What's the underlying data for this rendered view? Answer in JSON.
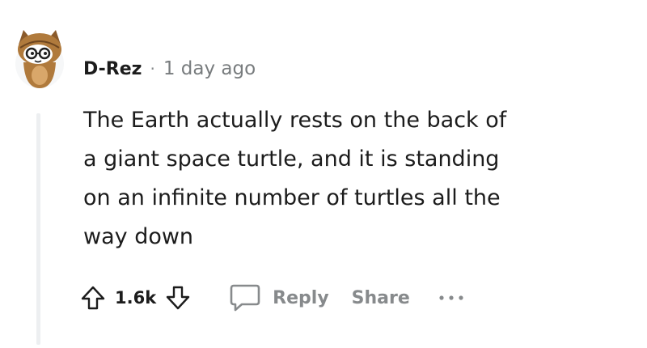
{
  "comment": {
    "author": "D-Rez",
    "separator": "·",
    "timestamp": "1 day ago",
    "lines": [
      "The Earth actually rests on the back of",
      "a giant space turtle, and it is standing",
      "on an infinite number of turtles all the",
      "way down"
    ]
  },
  "actions": {
    "upvote_icon": "arrow-up-outline-icon",
    "vote_count": "1.6k",
    "downvote_icon": "arrow-down-outline-icon",
    "reply_icon": "speech-bubble-icon",
    "reply_label": "Reply",
    "share_label": "Share",
    "more_icon": "ellipsis-icon"
  },
  "colors": {
    "text": "#1c1c1c",
    "meta": "#787c7e",
    "action": "#878a8c",
    "thread_line": "#edeff1",
    "avatar_brown": "#b07a3c"
  }
}
